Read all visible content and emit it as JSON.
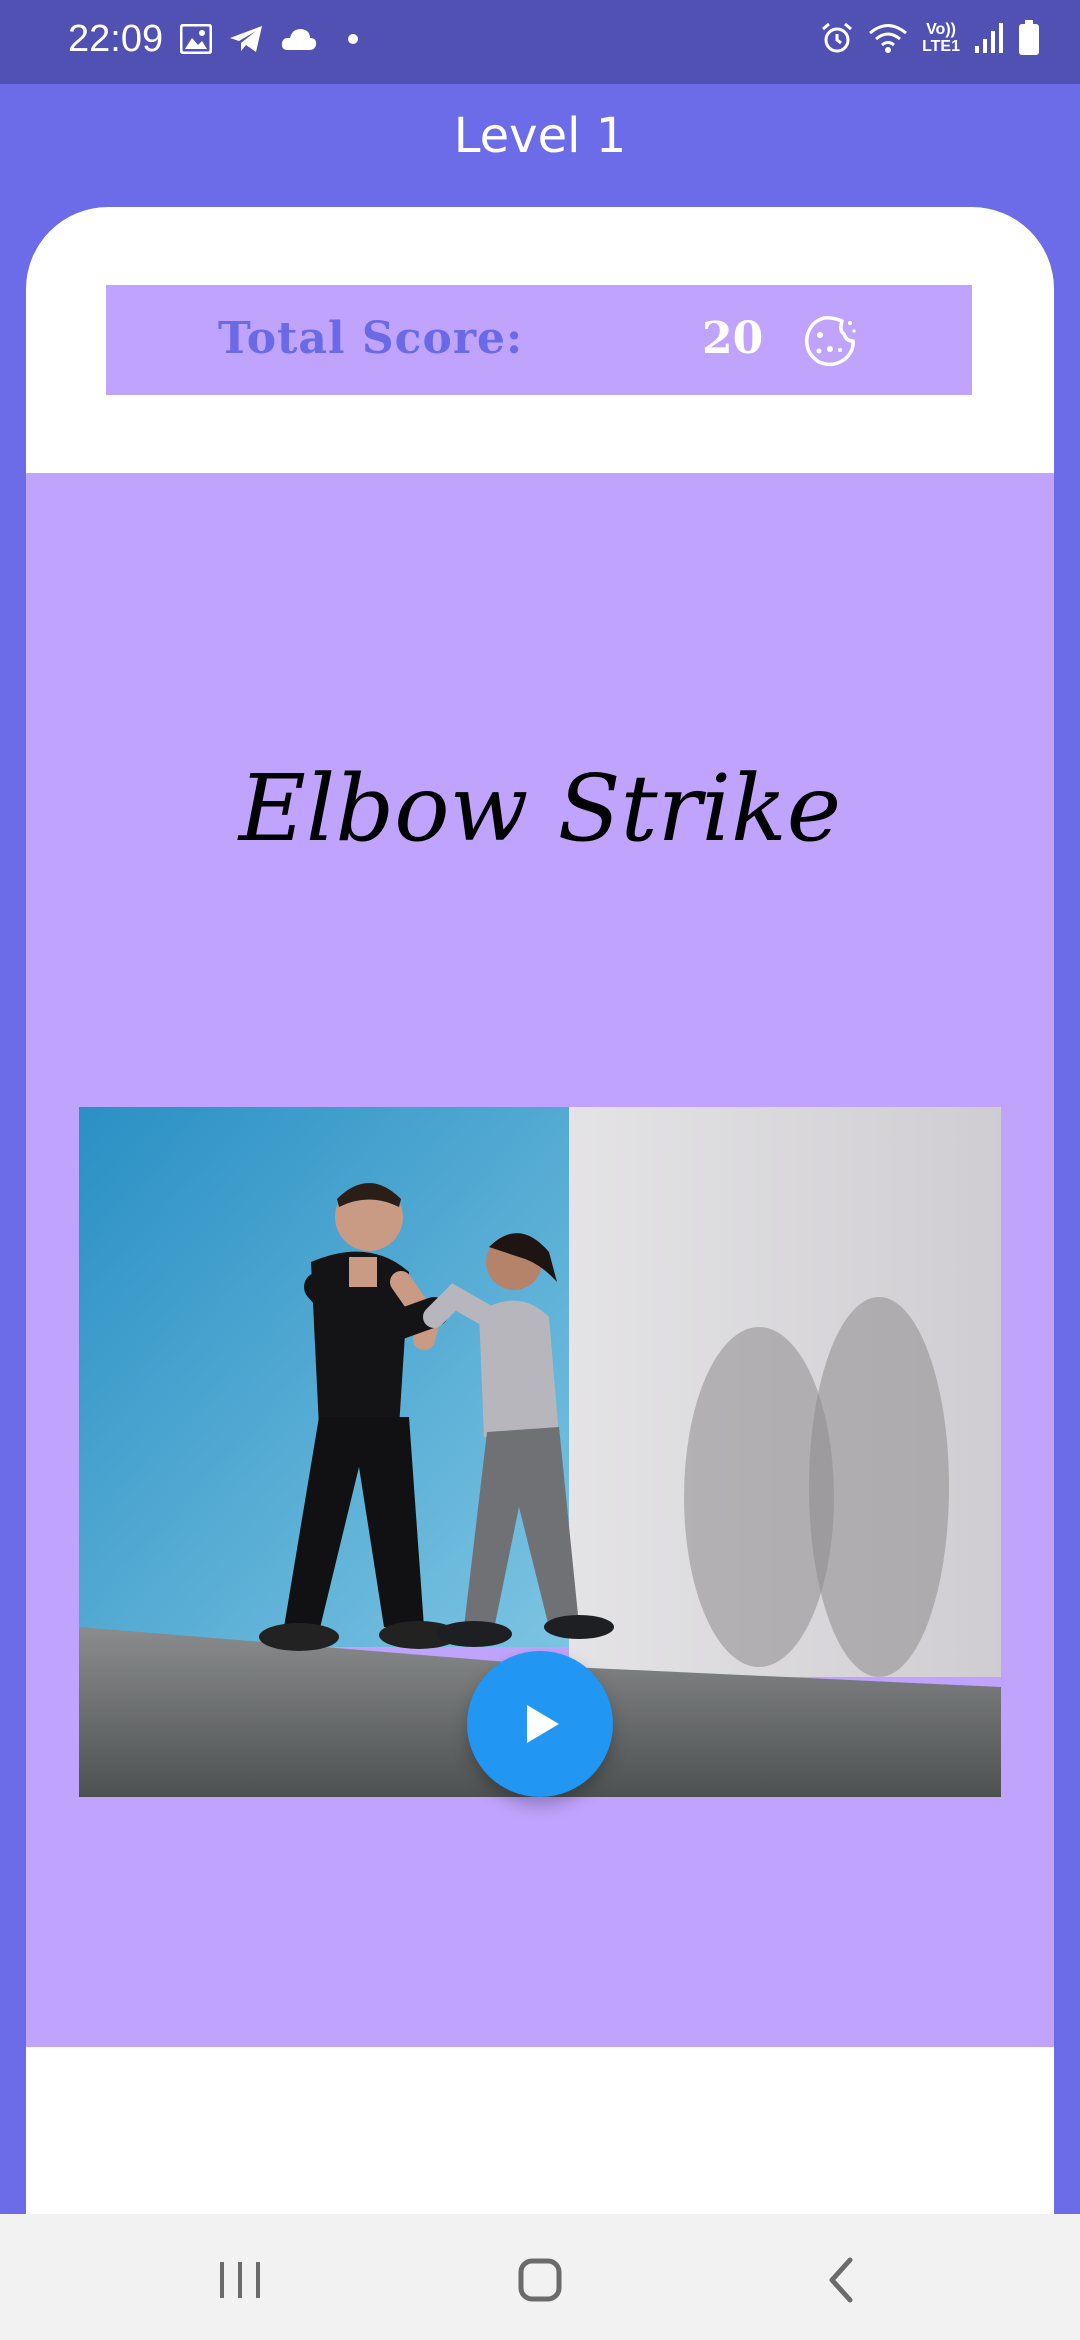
{
  "status_bar": {
    "time": "22:09",
    "left_icons": [
      "image-icon",
      "telegram-icon",
      "cloud-icon",
      "dot-icon"
    ],
    "right_icons": [
      "alarm-icon",
      "wifi-icon",
      "volte-icon",
      "signal-icon",
      "battery-icon"
    ],
    "volte_top": "Vo))",
    "volte_bottom": "LTE1"
  },
  "app_bar": {
    "title": "Level 1"
  },
  "score": {
    "label": "Total Score:",
    "value": "20",
    "icon": "cookie-icon"
  },
  "exercise": {
    "title": "Elbow Strike",
    "photo": "sparring-photo",
    "play_icon": "play-icon"
  },
  "nav_bar": {
    "items": [
      "recents-icon",
      "home-icon",
      "back-icon"
    ]
  },
  "colors": {
    "status_bar": "#5151b3",
    "app_bar": "#6c6be8",
    "panel": "#c0a3fd",
    "score_label": "#6a6ae6",
    "play_button": "#2196f3"
  }
}
